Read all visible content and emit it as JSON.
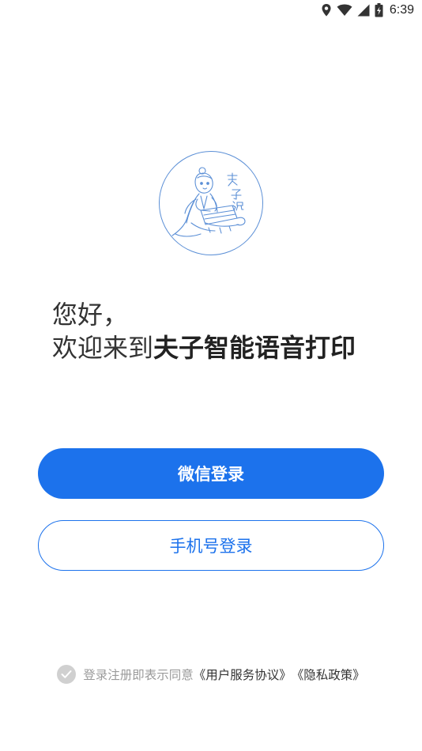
{
  "status_bar": {
    "time": "6:39",
    "icons": [
      "location-icon",
      "wifi-icon",
      "signal-icon",
      "battery-icon"
    ]
  },
  "logo": {
    "icon": "fuzi-character-logo",
    "text": "夫子说"
  },
  "greeting": {
    "line1": "您好，",
    "line2_prefix": "欢迎来到",
    "app_name": "夫子智能语音打印"
  },
  "buttons": {
    "wechat_login": "微信登录",
    "phone_login": "手机号登录"
  },
  "agreement": {
    "checked": false,
    "prefix": "登录注册即表示同意",
    "user_agreement": "《用户服务协议》",
    "privacy_policy": "《隐私政策》"
  },
  "colors": {
    "accent": "#1c72ec",
    "logo_line": "#5b8fd6",
    "muted_text": "#9a9a9a",
    "check_gray": "#d0d0d0"
  }
}
